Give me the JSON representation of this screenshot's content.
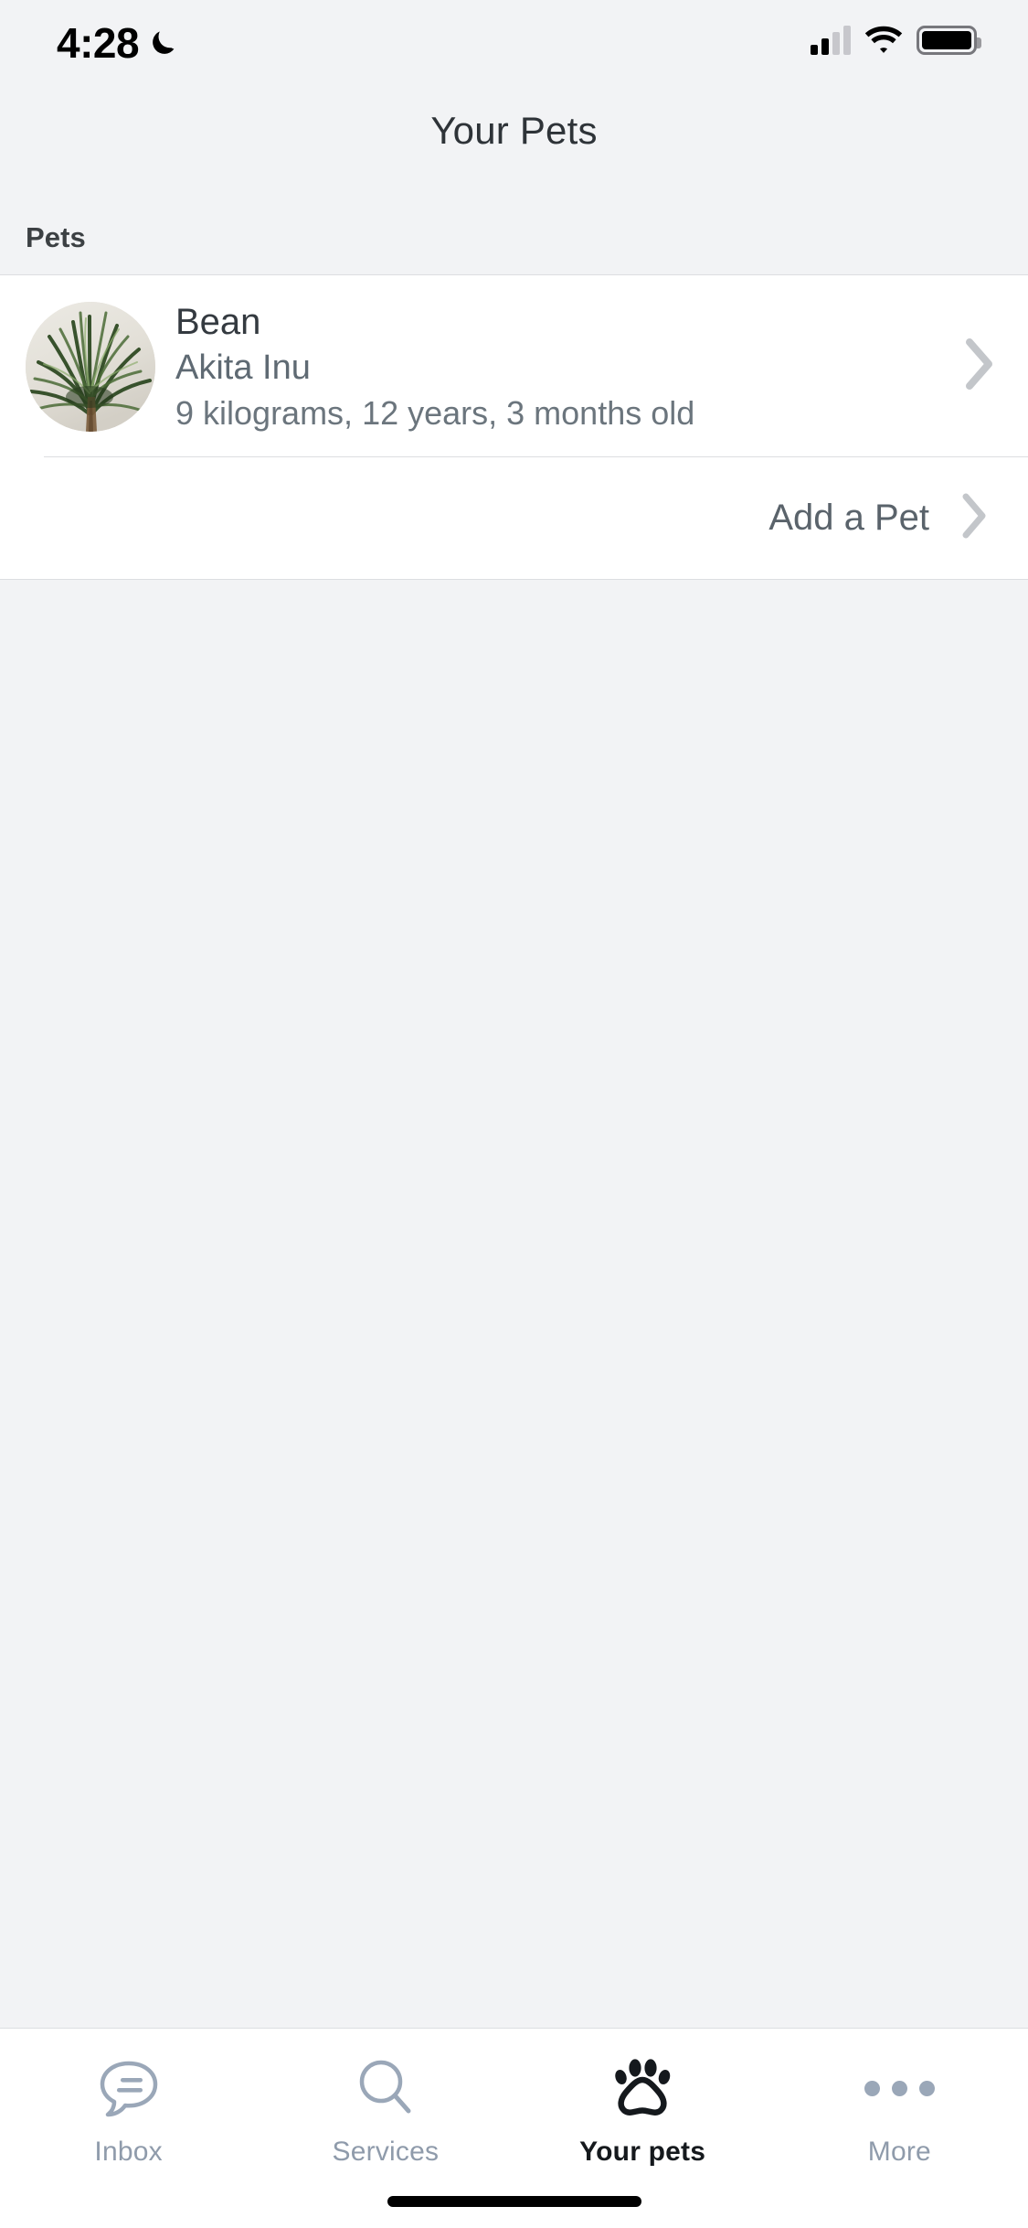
{
  "status_bar": {
    "time": "4:28",
    "dnd_icon": "moon-icon",
    "signal_icon": "cellular-signal-icon",
    "signal_bars_total": 4,
    "signal_bars_active": 2,
    "wifi_icon": "wifi-icon",
    "battery_icon": "battery-icon",
    "battery_level_percent": 100
  },
  "header": {
    "title": "Your Pets"
  },
  "content": {
    "section_title": "Pets",
    "pets": [
      {
        "name": "Bean",
        "breed": "Akita Inu",
        "details": "9 kilograms, 12 years, 3 months old",
        "avatar_name": "pet-avatar-photo",
        "chevron_icon": "chevron-right-icon"
      }
    ],
    "add_pet": {
      "label": "Add a Pet",
      "chevron_icon": "chevron-right-icon"
    }
  },
  "tab_bar": {
    "active_index": 2,
    "tabs": [
      {
        "label": "Inbox",
        "icon": "speech-bubble-icon",
        "active": false
      },
      {
        "label": "Services",
        "icon": "magnifier-icon",
        "active": false
      },
      {
        "label": "Your pets",
        "icon": "paw-print-icon",
        "active": true
      },
      {
        "label": "More",
        "icon": "ellipsis-icon",
        "active": false
      }
    ]
  },
  "home_indicator": {
    "name": "home-indicator-bar"
  },
  "colors": {
    "page_background": "#f2f3f5",
    "card_background": "#ffffff",
    "divider": "#dcdee1",
    "primary_text": "#343a40",
    "secondary_text": "#6b757d",
    "tab_inactive": "#9aa7b8",
    "tab_active": "#15191d",
    "chevron": "#c3c6ca"
  }
}
